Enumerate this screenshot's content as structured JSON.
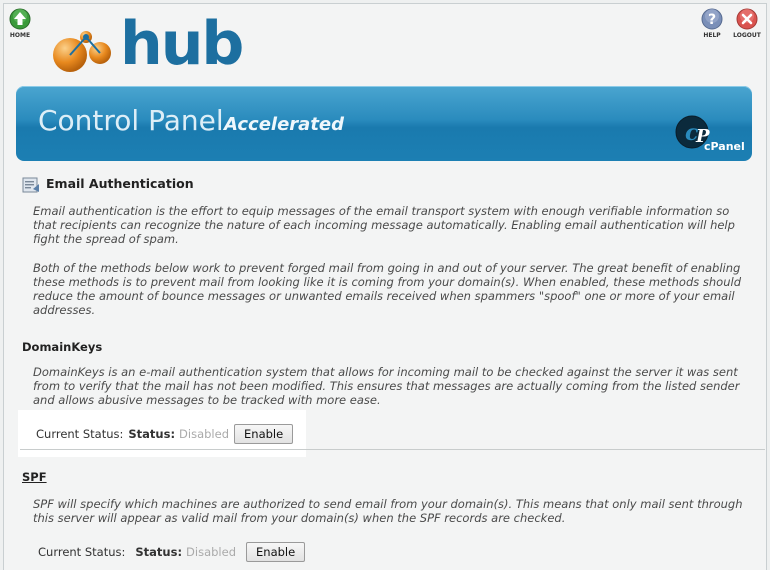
{
  "top_nav": {
    "home_label": "HOME",
    "help_label": "HELP",
    "logout_label": "LOGOUT",
    "home_icon": "home-arrow-icon",
    "help_icon": "question-icon",
    "logout_icon": "close-icon"
  },
  "logo": {
    "text": "hub"
  },
  "banner": {
    "title": "Control Panel",
    "subtitle": "Accelerated",
    "brand": "cPanel"
  },
  "email_auth": {
    "title": "Email Authentication",
    "intro_1": "Email authentication is the effort to equip messages of the email transport system with enough verifiable information so that recipients can recognize the nature of each incoming message automatically. Enabling email authentication will help fight the spread of spam.",
    "intro_2": "Both of the methods below work to prevent forged mail from going in and out of your server. The great benefit of enabling these methods is to prevent mail from looking like it is coming from your domain(s). When enabled, these methods should reduce the amount of bounce messages or unwanted emails received when spammers \"spoof\" one or more of your email addresses."
  },
  "domainkeys": {
    "title": "DomainKeys",
    "description": "DomainKeys is an e-mail authentication system that allows for incoming mail to be checked against the server it was sent from to verify that the mail has not been modified. This ensures that messages are actually coming from the listed sender and allows abusive messages to be tracked with more ease.",
    "current_status_label": "Current Status:",
    "status_label": "Status:",
    "status_value": "Disabled",
    "button_label": "Enable"
  },
  "spf": {
    "title": "SPF",
    "description": "SPF will specify which machines are authorized to send email from your domain(s). This means that only mail sent through this server will appear as valid mail from your domain(s) when the SPF records are checked.",
    "current_status_label": "Current Status:",
    "status_label": "Status:",
    "status_value": "Disabled",
    "button_label": "Enable"
  },
  "colors": {
    "banner": "#2a8bbd",
    "logo": "#1d6fa0",
    "orange": "#e8891e",
    "disabled_text": "#aaaaaa"
  }
}
